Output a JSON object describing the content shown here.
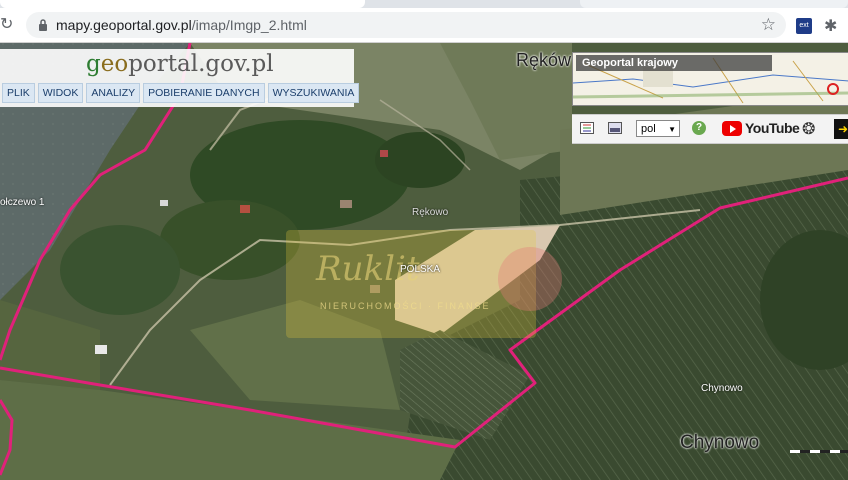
{
  "browser": {
    "url_host": "mapy.geoportal.gov.pl",
    "url_path": "/imap/Imgp_2.html"
  },
  "logo": {
    "part_g": "g",
    "part_eo": "eo",
    "part_portal": "portal",
    "part_gov": ".gov.pl"
  },
  "menu": {
    "items": [
      "PLIK",
      "WIDOK",
      "ANALIZY",
      "POBIERANIE DANYCH",
      "WYSZUKIWANIA"
    ]
  },
  "minimap": {
    "title": "Geoportal krajowy"
  },
  "toolbar": {
    "language": "pol",
    "help": "?",
    "youtube": "YouTube"
  },
  "map": {
    "labels": {
      "rekowo_large": "Ręków",
      "rekowo_small": "Rękowo",
      "polska": "POLSKA",
      "golczewo": "ołczewo 1",
      "chynowo_small": "Chynowo",
      "chynowo_large": "Chynowo"
    },
    "boundary_color": "#e0217a"
  },
  "watermark": {
    "text": "Ruklit",
    "subtitle": "NIERUCHOMOŚCI · FINANSE"
  }
}
